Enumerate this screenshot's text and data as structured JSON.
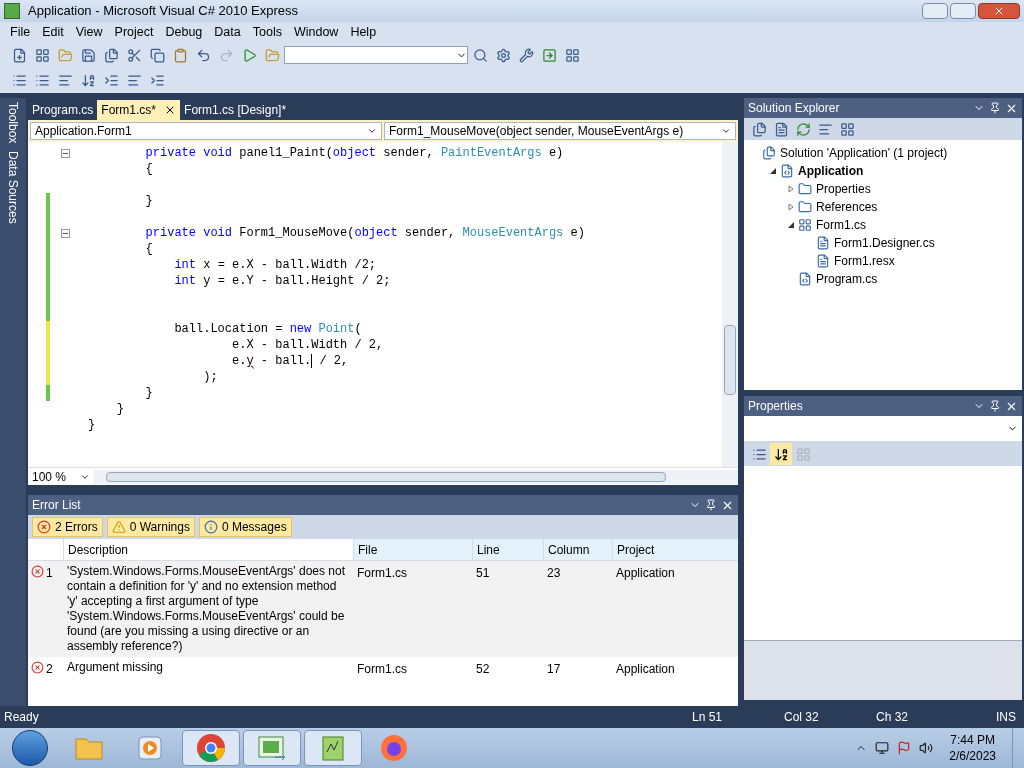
{
  "window": {
    "title": "Application - Microsoft Visual C# 2010 Express"
  },
  "menu": [
    "File",
    "Edit",
    "View",
    "Project",
    "Debug",
    "Data",
    "Tools",
    "Window",
    "Help"
  ],
  "side_strip": [
    "Toolbox",
    "Data Sources"
  ],
  "doc_tabs": [
    {
      "label": "Program.cs",
      "selected": false
    },
    {
      "label": "Form1.cs*",
      "selected": true
    },
    {
      "label": "Form1.cs [Design]*",
      "selected": false
    }
  ],
  "nav_bar": {
    "type_box": "Application.Form1",
    "member_box": "Form1_MouseMove(object sender, MouseEventArgs e)"
  },
  "code": [
    {
      "fold": true,
      "changed": false,
      "tokens": [
        {
          "kind": "keyword",
          "text": "        private void"
        },
        {
          "kind": "plain",
          "text": " panel1_Paint("
        },
        {
          "kind": "keyword",
          "text": "object"
        },
        {
          "kind": "plain",
          "text": " sender, "
        },
        {
          "kind": "type",
          "text": "PaintEventArgs"
        },
        {
          "kind": "plain",
          "text": " e)"
        }
      ]
    },
    {
      "fold": false,
      "changed": false,
      "tokens": [
        {
          "kind": "plain",
          "text": "        {"
        }
      ]
    },
    {
      "fold": false,
      "changed": false
    },
    {
      "fold": false,
      "changed": true,
      "saved": true,
      "tokens": [
        {
          "kind": "plain",
          "text": "        }"
        }
      ]
    },
    {
      "fold": false,
      "changed": true,
      "saved": true
    },
    {
      "fold": true,
      "changed": true,
      "saved": true,
      "tokens": [
        {
          "kind": "keyword",
          "text": "        private void"
        },
        {
          "kind": "plain",
          "text": " Form1_MouseMove("
        },
        {
          "kind": "keyword",
          "text": "object"
        },
        {
          "kind": "plain",
          "text": " sender, "
        },
        {
          "kind": "type",
          "text": "MouseEventArgs"
        },
        {
          "kind": "plain",
          "text": " e)"
        }
      ]
    },
    {
      "fold": false,
      "changed": true,
      "saved": true,
      "tokens": [
        {
          "kind": "plain",
          "text": "        {"
        }
      ]
    },
    {
      "fold": false,
      "changed": true,
      "saved": true,
      "tokens": [
        {
          "kind": "keyword",
          "text": "            int"
        },
        {
          "kind": "plain",
          "text": " x = e.X - ball.Width /2;"
        }
      ]
    },
    {
      "fold": false,
      "changed": true,
      "saved": true,
      "tokens": [
        {
          "kind": "keyword",
          "text": "            int"
        },
        {
          "kind": "plain",
          "text": " y = e.Y - ball.Height / 2;"
        }
      ]
    },
    {
      "fold": false,
      "changed": true,
      "saved": true
    },
    {
      "fold": false,
      "changed": true,
      "saved": true
    },
    {
      "fold": false,
      "changed": true,
      "saved": false,
      "tokens": [
        {
          "kind": "plain",
          "text": "            ball.Location = "
        },
        {
          "kind": "keyword",
          "text": "new "
        },
        {
          "kind": "type",
          "text": "Point"
        },
        {
          "kind": "plain",
          "text": "("
        }
      ]
    },
    {
      "fold": false,
      "changed": true,
      "saved": false,
      "tokens": [
        {
          "kind": "plain",
          "text": "                    e.X - ball.Width / 2,"
        }
      ]
    },
    {
      "fold": false,
      "changed": true,
      "saved": false,
      "tokens": [
        {
          "kind": "plain",
          "text": "                    e."
        },
        {
          "kind": "error",
          "text": "y"
        },
        {
          "kind": "plain",
          "text": " - ball."
        },
        {
          "kind": "caret"
        },
        {
          "kind": "plain",
          "text": " / 2,"
        }
      ]
    },
    {
      "fold": false,
      "changed": true,
      "saved": false,
      "tokens": [
        {
          "kind": "plain",
          "text": "                );"
        }
      ]
    },
    {
      "fold": false,
      "changed": true,
      "saved": true,
      "tokens": [
        {
          "kind": "plain",
          "text": "        }"
        }
      ]
    },
    {
      "fold": false,
      "changed": false,
      "tokens": [
        {
          "kind": "plain",
          "text": "    }"
        }
      ]
    },
    {
      "fold": false,
      "changed": false,
      "tokens": [
        {
          "kind": "plain",
          "text": "}"
        }
      ]
    }
  ],
  "zoom": "100 %",
  "error_list": {
    "title": "Error List",
    "filters": [
      {
        "kind": "error",
        "label": "2 Errors",
        "selected": true
      },
      {
        "kind": "warning",
        "label": "0 Warnings",
        "selected": true
      },
      {
        "kind": "message",
        "label": "0 Messages",
        "selected": true
      }
    ],
    "columns": [
      "Description",
      "File",
      "Line",
      "Column",
      "Project"
    ],
    "rows": [
      {
        "number": "1",
        "description": "'System.Windows.Forms.MouseEventArgs' does not contain a definition for 'y' and no extension method 'y' accepting a first argument of type 'System.Windows.Forms.MouseEventArgs' could be found (are you missing a using directive or an assembly reference?)",
        "file": "Form1.cs",
        "line": "51",
        "column": "23",
        "project": "Application"
      },
      {
        "number": "2",
        "description": "Argument missing",
        "file": "Form1.cs",
        "line": "52",
        "column": "17",
        "project": "Application"
      }
    ]
  },
  "solution_explorer": {
    "title": "Solution Explorer",
    "tree": [
      {
        "label": "Solution 'Application' (1 project)",
        "kind": "solution",
        "bold": false,
        "children": [
          {
            "label": "Application",
            "kind": "project",
            "bold": true,
            "expanded": true,
            "children": [
              {
                "label": "Properties",
                "kind": "properties",
                "bold": false,
                "expanded": false
              },
              {
                "label": "References",
                "kind": "references",
                "bold": false,
                "expanded": false
              },
              {
                "label": "Form1.cs",
                "kind": "form",
                "bold": false,
                "expanded": true,
                "children": [
                  {
                    "label": "Form1.Designer.cs",
                    "kind": "file",
                    "bold": false
                  },
                  {
                    "label": "Form1.resx",
                    "kind": "file",
                    "bold": false
                  }
                ]
              },
              {
                "label": "Program.cs",
                "kind": "csfile",
                "bold": false
              }
            ]
          }
        ]
      }
    ]
  },
  "properties": {
    "title": "Properties"
  },
  "status_bar": {
    "message": "Ready",
    "line": "Ln 51",
    "column": "Col 32",
    "char": "Ch 32",
    "mode": "INS"
  },
  "taskbar": {
    "apps": [
      {
        "kind": "explorer",
        "running": false
      },
      {
        "kind": "media",
        "running": false
      },
      {
        "kind": "chrome",
        "running": true
      },
      {
        "kind": "csharp",
        "running": true
      },
      {
        "kind": "notepad",
        "running": true
      },
      {
        "kind": "firefox",
        "running": false
      }
    ],
    "time": "7:44 PM",
    "date": "2/6/2023"
  }
}
